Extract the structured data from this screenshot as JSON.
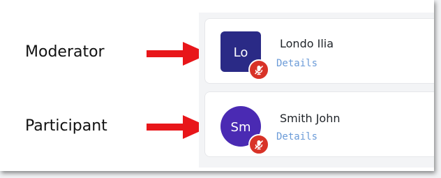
{
  "annotations": {
    "moderator_label": "Moderator",
    "participant_label": "Participant",
    "arrow_color": "#e8161a"
  },
  "participants": [
    {
      "initials": "Lo",
      "name": "Londo Ilia",
      "details_link": "Details",
      "avatar_shape": "square",
      "avatar_color": "#2a2a86",
      "status_icon": "microphone-muted-icon"
    },
    {
      "initials": "Sm",
      "name": "Smith John",
      "details_link": "Details",
      "avatar_shape": "circle",
      "avatar_color": "#4a2ab3",
      "status_icon": "microphone-muted-icon"
    }
  ],
  "colors": {
    "muted_badge": "#d83227",
    "details_link": "#6b9bd8"
  }
}
